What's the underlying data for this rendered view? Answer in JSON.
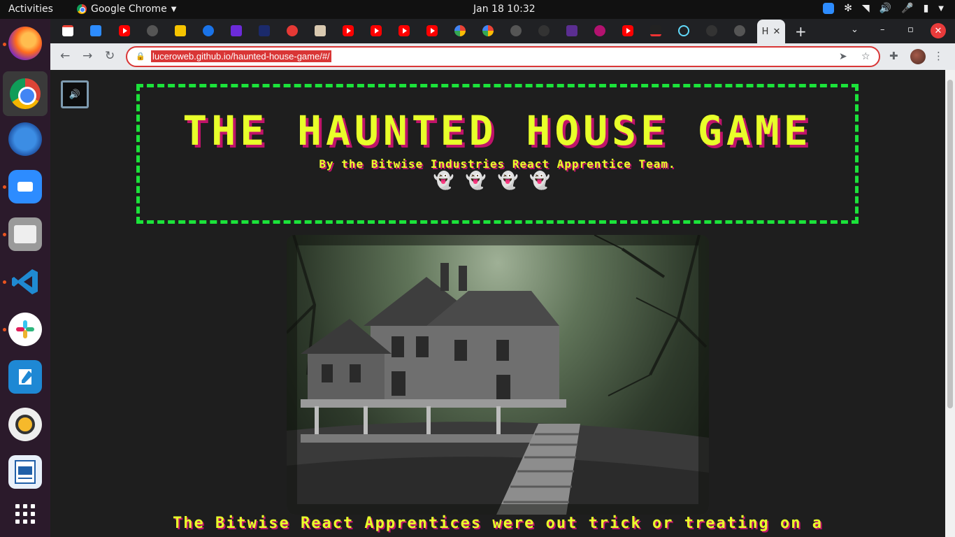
{
  "os": {
    "activities": "Activities",
    "app_name": "Google Chrome",
    "clock": "Jan 18  10:32"
  },
  "browser": {
    "active_tab_label": "H",
    "url": "luceroweb.github.io/haunted-house-game/#/"
  },
  "page": {
    "title": "THE HAUNTED HOUSE GAME",
    "byline": "By the Bitwise Industries React Apprentice Team.",
    "ghosts": "👻👻👻👻",
    "story": "The Bitwise React Apprentices were out trick or treating on a"
  },
  "colors": {
    "title_yellow": "#e8ff2a",
    "title_shadow": "#c0136a",
    "banner_border": "#1be33a",
    "page_bg": "#1e1e1e"
  }
}
